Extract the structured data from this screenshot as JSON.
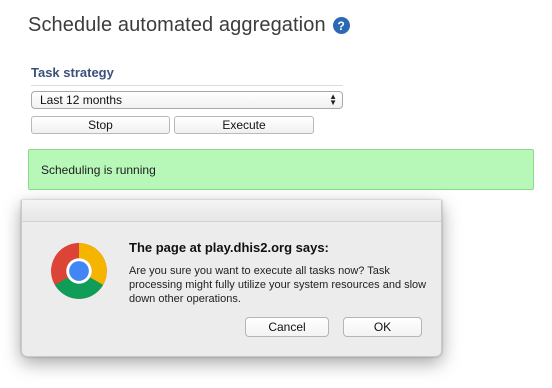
{
  "page": {
    "title": "Schedule automated aggregation",
    "help_icon": "question-icon"
  },
  "strategy": {
    "label": "Task strategy",
    "selected": "Last 12 months",
    "stop_label": "Stop",
    "execute_label": "Execute"
  },
  "status": {
    "message": "Scheduling is running",
    "color": "#b7f7b7"
  },
  "dialog": {
    "heading": "The page at play.dhis2.org says:",
    "message": "Are you sure you want to execute all tasks now? Task processing might fully utilize your system resources and slow down other operations.",
    "cancel_label": "Cancel",
    "ok_label": "OK",
    "icon": "chrome-logo-icon"
  }
}
